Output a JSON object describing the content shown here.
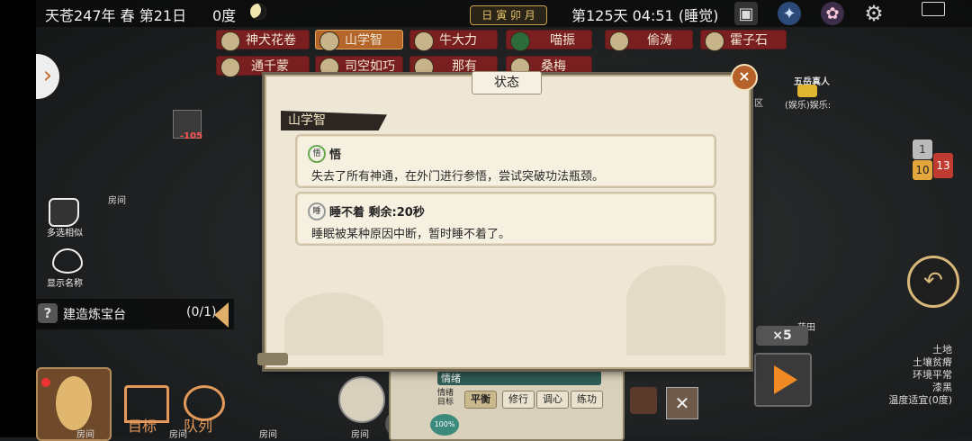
{
  "topbar": {
    "date": "天苍247年 春 第21日",
    "temperature": "0度",
    "calendar": "日 寅 卯 月",
    "time": "第125天 04:51 (睡觉)"
  },
  "name_chips": [
    {
      "name": "神犬花卷",
      "color": "#7a1f1f"
    },
    {
      "name": "山学智",
      "color": "#b3652a"
    },
    {
      "name": "牛大力",
      "color": "#7a1f1f"
    },
    {
      "name": "喵振",
      "color": "#7a1f1f"
    },
    {
      "name": "偷涛",
      "color": "#7a1f1f"
    },
    {
      "name": "霍子石",
      "color": "#7a1f1f"
    },
    {
      "name": "通千蒙",
      "color": "#7a1f1f"
    },
    {
      "name": "司空如巧",
      "color": "#7a1f1f"
    },
    {
      "name": "那有",
      "color": "#7a1f1f"
    },
    {
      "name": "桑梅",
      "color": "#7a1f1f"
    }
  ],
  "map": {
    "marker_value": "-105",
    "room_label_1": "房间",
    "area_label": "五易区",
    "npc_title": "五岳真人",
    "npc_status": "(娱乐)娱乐:",
    "field_label": "药田"
  },
  "side_tools": {
    "multi_select": "多选相似",
    "show_names": "显示名称"
  },
  "build": {
    "label": "建造炼宝台",
    "progress": "(0/1)"
  },
  "bottom_left": {
    "target": "目标",
    "queue": "队列",
    "rooms": [
      "房间",
      "房间",
      "房间",
      "房间"
    ]
  },
  "dialog": {
    "title": "状态",
    "character": "山学智",
    "statuses": [
      {
        "icon": "悟",
        "title": "悟",
        "description": "失去了所有神通，在外门进行参悟，尝试突破功法瓶颈。"
      },
      {
        "icon": "睡",
        "title": "睡不着  剩余:20秒",
        "description": "睡眠被某种原因中断，暂时睡不着了。"
      }
    ]
  },
  "mood_panel": {
    "header": "情绪",
    "target_label": "情绪目标",
    "options": [
      "平衡",
      "修行",
      "调心",
      "练功"
    ],
    "selected": "平衡",
    "percent": "100%"
  },
  "notifications": {
    "n1": "1",
    "n2": "10",
    "n3": "13"
  },
  "speed": "×5",
  "environment": [
    "土地",
    "土壤贫瘠",
    "环境平常",
    "漆黑",
    "温度适宜(0度)"
  ],
  "colors": {
    "accent": "#f08a24",
    "chip_red": "#7a1f1f",
    "chip_selected": "#b3652a"
  }
}
